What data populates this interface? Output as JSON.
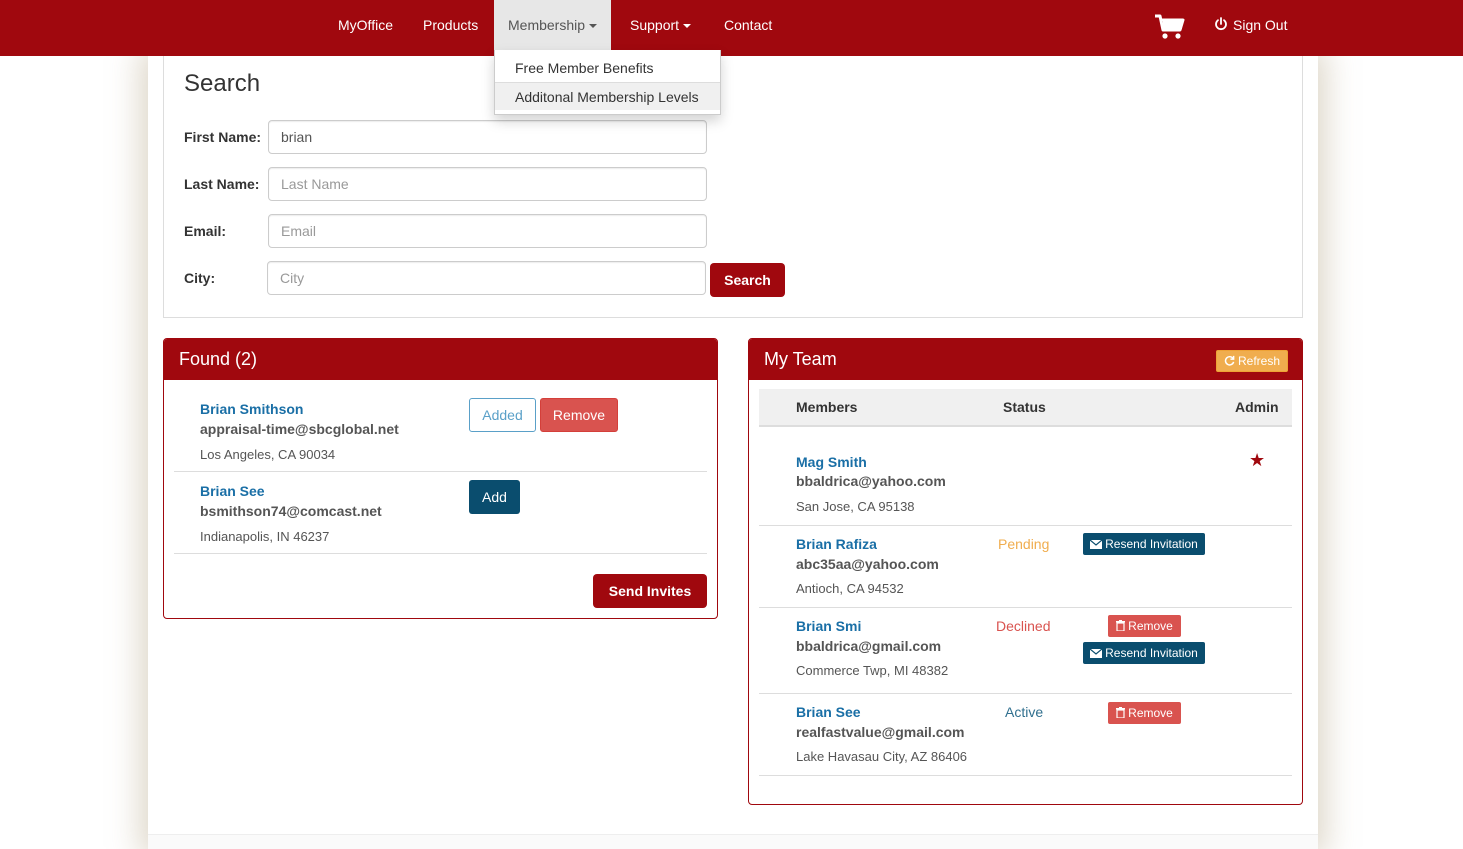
{
  "nav": {
    "items": [
      {
        "label": "MyOffice"
      },
      {
        "label": "Products"
      },
      {
        "label": "Membership"
      },
      {
        "label": "Support"
      },
      {
        "label": "Contact"
      }
    ],
    "sign_out": "Sign Out"
  },
  "dropdown": {
    "items": [
      {
        "label": "Free Member Benefits"
      },
      {
        "label": "Additonal Membership Levels"
      }
    ]
  },
  "search": {
    "title": "Search",
    "first_name": {
      "label": "First Name:",
      "value": "brian",
      "placeholder": "First Name"
    },
    "last_name": {
      "label": "Last Name:",
      "value": "",
      "placeholder": "Last Name"
    },
    "email": {
      "label": "Email:",
      "value": "",
      "placeholder": "Email"
    },
    "city": {
      "label": "City:",
      "value": "",
      "placeholder": "City"
    },
    "button": "Search"
  },
  "found": {
    "title": "Found (2)",
    "results": [
      {
        "name": "Brian Smithson",
        "email": "appraisal-time@sbcglobal.net",
        "city": "Los Angeles, CA 90034",
        "added_label": "Added",
        "remove_label": "Remove"
      },
      {
        "name": "Brian See",
        "email": "bsmithson74@comcast.net",
        "city": "Indianapolis, IN 46237",
        "add_label": "Add"
      }
    ],
    "send_invites": "Send Invites"
  },
  "team": {
    "title": "My Team",
    "refresh": "Refresh",
    "columns": {
      "members": "Members",
      "status": "Status",
      "admin": "Admin"
    },
    "rows": [
      {
        "name": "Mag Smith",
        "email": "bbaldrica@yahoo.com",
        "city": "San Jose, CA 95138",
        "status": "",
        "admin": "★"
      },
      {
        "name": "Brian Rafiza",
        "email": "abc35aa@yahoo.com",
        "city": "Antioch, CA 94532",
        "status": "Pending",
        "resend": "Resend Invitation"
      },
      {
        "name": "Brian Smi",
        "email": "bbaldrica@gmail.com",
        "city": "Commerce Twp, MI 48382",
        "status": "Declined",
        "remove": "Remove",
        "resend": "Resend Invitation"
      },
      {
        "name": "Brian See",
        "email": "realfastvalue@gmail.com",
        "city": "Lake Havasau City, AZ 86406",
        "status": "Active",
        "remove": "Remove"
      }
    ]
  },
  "colors": {
    "brand": "#a0080e",
    "link": "#1a6fa6",
    "pending": "#f0ad4e",
    "declined": "#d9534f",
    "active": "#31708f",
    "navy_button": "#0a4d6e"
  },
  "icons": [
    "cart-icon",
    "power-icon",
    "refresh-icon",
    "envelope-icon",
    "trash-icon",
    "star-icon"
  ]
}
